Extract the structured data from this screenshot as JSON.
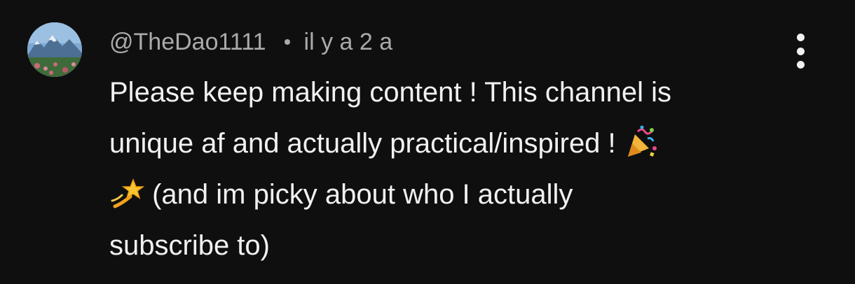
{
  "comment": {
    "author": "@TheDao1111",
    "timestamp": "il y a 2 a",
    "avatar_icon": "mountain-landscape-avatar",
    "text_lines": [
      {
        "text": "Please keep making content ! This channel is"
      },
      {
        "text": "unique af and actually practical/inspired ! ",
        "emoji_after": "party-popper-emoji"
      },
      {
        "emoji_before": "dizzy-star-emoji",
        "text": " (and im picky about who I actually"
      },
      {
        "text": "subscribe to)"
      }
    ],
    "menu_icon": "more-vertical-icon"
  },
  "colors": {
    "background": "#0f0f0f",
    "primary_text": "#f1f1f1",
    "secondary_text": "#aaaaaa"
  }
}
